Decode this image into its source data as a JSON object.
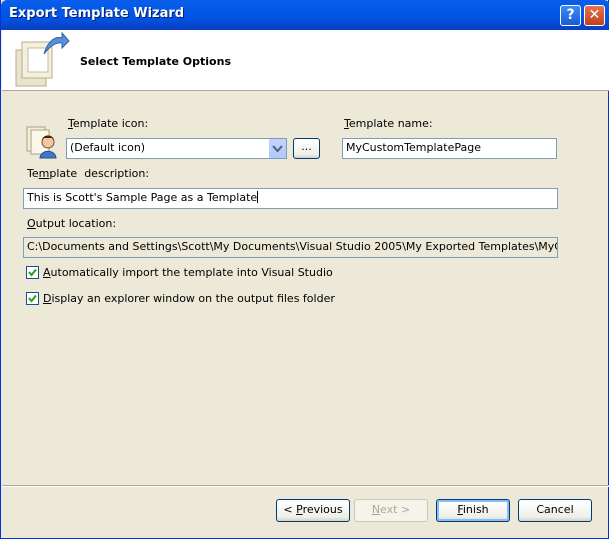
{
  "window": {
    "title": "Export Template Wizard",
    "help_glyph": "?",
    "close_glyph": "✕"
  },
  "header": {
    "title": "Select Template Options",
    "icon": "template-wizard-icon"
  },
  "form": {
    "icon_label_pre": "",
    "icon_label_mn": "T",
    "icon_label_post": "emplate icon:",
    "icon_value": "(Default icon)",
    "browse_label": "...",
    "name_label_mn": "T",
    "name_label_post": "emplate name:",
    "name_value": "MyCustomTemplatePage",
    "desc_label_pre": "Te",
    "desc_label_mn": "m",
    "desc_label_post": "plate  description:",
    "desc_value": "This is Scott's Sample Page as a Template",
    "output_label_mn": "O",
    "output_label_post": "utput location:",
    "output_value": "C:\\Documents and Settings\\Scott\\My Documents\\Visual Studio 2005\\My Exported Templates\\MyCustomTemplatePage.zip",
    "auto_import_mn": "A",
    "auto_import_post": "utomatically import the template into Visual Studio",
    "auto_import_checked": true,
    "explorer_mn": "D",
    "explorer_post": "isplay an explorer window on the output files folder",
    "explorer_checked": true
  },
  "buttons": {
    "previous_pre": "< ",
    "previous_mn": "P",
    "previous_post": "revious",
    "next_mn": "N",
    "next_post": "ext >",
    "finish_mn": "F",
    "finish_post": "inish",
    "cancel": "Cancel"
  }
}
